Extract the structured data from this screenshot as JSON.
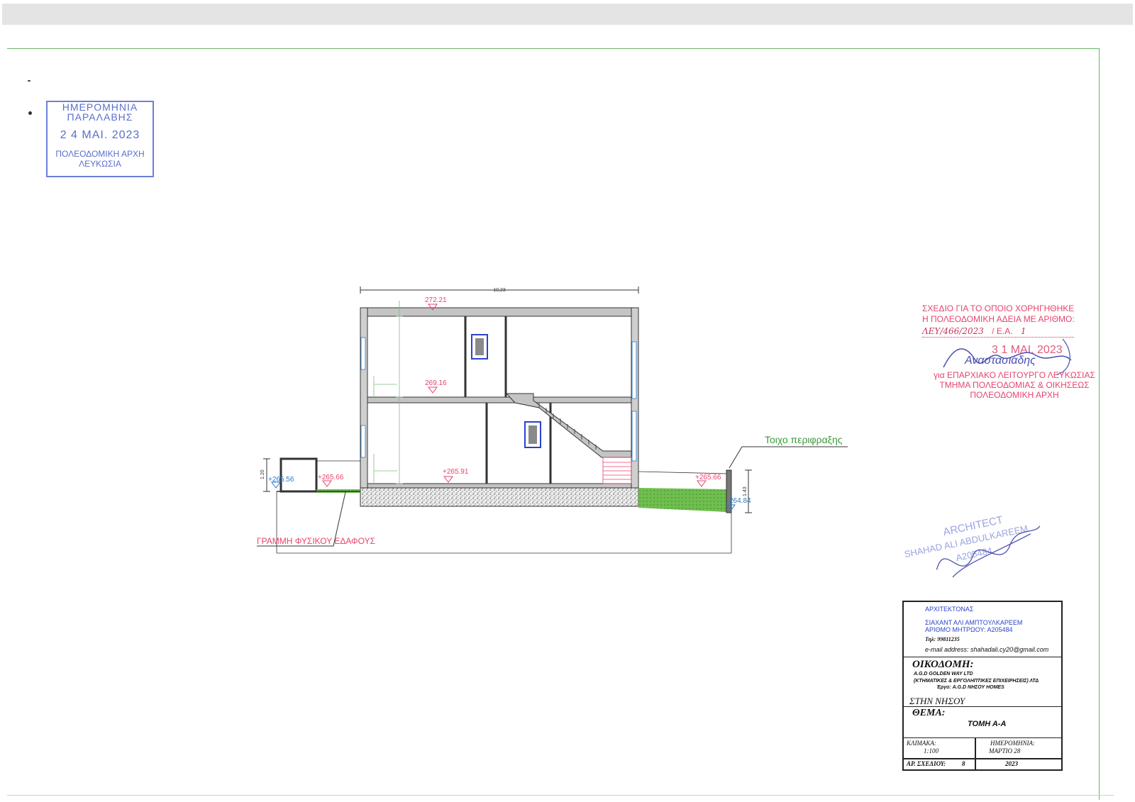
{
  "reception_stamp": {
    "heading_line1": "ΗΜΕΡΟΜΗΝΙΑ",
    "heading_line2": "ΠΑΡΑΛΑΒΗΣ",
    "date": "2 4 ΜΑΙ. 2023",
    "authority_line1": "ΠΟΛΕΟΔΟΜΙΚΗ ΑΡΧΗ",
    "authority_line2": "ΛΕΥΚΩΣΙΑ"
  },
  "approval_stamp": {
    "line1": "ΣΧΕΔΙΟ ΓΙΑ ΤΟ ΟΠΟΙΟ ΧΟΡΗΓΗΘΗΚΕ",
    "line2": "Η ΠΟΛΕΟΔΟΜΙΚΗ ΑΔΕΙΑ ΜΕ ΑΡΙΘΜΟ:",
    "permit_number": "ΛΕΥ/466/2023",
    "ea_label": "/ Ε.Α.",
    "ea_value": "1",
    "date": "3 1 ΜΑΙ. 2023",
    "signature": "Αναστασιάδης",
    "line3": "για ΕΠΑΡΧΙΑΚΟ ΛΕΙΤΟΥΡΓΟ ΛΕΥΚΩΣΙΑΣ",
    "line4": "ΤΜΗΜΑ ΠΟΛΕΟΔΟΜΙΑΣ & ΟΙΚΗΣΕΩΣ",
    "line5": "ΠΟΛΕΟΔΟΜΙΚΗ ΑΡΧΗ"
  },
  "architect_stamp": {
    "line1": "ARCHITECT",
    "line2": "SHAHAD ALI ABDULKAREEM",
    "line3": "A205484"
  },
  "drawing": {
    "overall_width": "10,23",
    "levels": {
      "roof": "272.21",
      "first_floor": "269.16",
      "ground_floor": "+265.91",
      "left_ground": "+265.66",
      "right_ground": "+265.66",
      "left_low": "+265.56",
      "right_low": "264.84"
    },
    "dims": {
      "left_height": "1.20",
      "right_height": "1.43"
    },
    "labels": {
      "boundary_wall": "Τοιχο περιφραξης",
      "natural_ground_line": "ΓΡΑΜΜΗ ΦΥΣΙΚΟΥ ΕΔΑΦΟΥΣ"
    }
  },
  "title_block": {
    "architect_heading": "ΑΡΧΙΤΕΚΤΟΝΑΣ",
    "architect_name": "ΣΙΑΧΑΝΤ ΑΛΙ ΑΜΠΤΟΥΛΚΑΡΕΕΜ",
    "registry": "ΑΡΙΘΜΟ ΜΗΤΡΩΟΥ: Α205484",
    "phone": "Τηλ: 99811235",
    "email": "e-mail address: shahadali.cy20@gmail.com",
    "client_label": "ΟΙΚΟΔΟΜΗ:",
    "client_name": "A.G.D GOLDEN WAY LTD",
    "client_desc": "(ΚΤΗΜΑΤΙΚΕΣ & ΕΡΓΟΛΗΠΤΙΚΕΣ ΕΠΙΧΕΙΡΗΣΕΙΣ) ΛΤΔ",
    "project": "Έργο: A.G.D ΝΗΣΟΥ HOMES",
    "location": "ΣΤΗΝ ΝΗΣΟΥ",
    "subject_label": "ΘΕΜΑ:",
    "subject": "ΤΟΜΗ Α-Α",
    "scale_label": "ΚΛΙΜΑΚΑ:",
    "scale": "1:100",
    "date_label": "ΗΜΕΡΟΜΗΝΙΑ:",
    "date": "ΜΑΡΤΙΟ 28",
    "drawing_no_label": "ΑΡ. ΣΧΕΔΙΟΥ:",
    "drawing_no": "8",
    "year": "2023"
  }
}
